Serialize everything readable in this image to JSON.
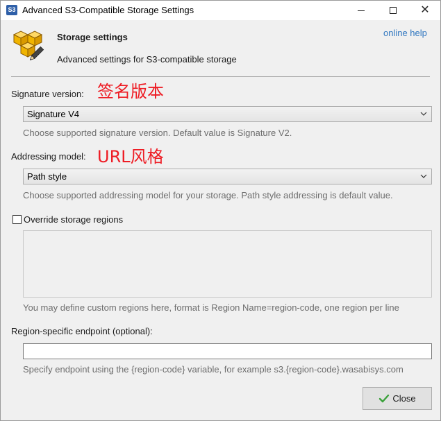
{
  "window": {
    "app_icon_text": "S3",
    "title": "Advanced S3-Compatible Storage Settings",
    "controls": {
      "minimize_icon": "minimize-icon",
      "maximize_icon": "maximize-icon",
      "close_icon": "close-icon",
      "close_glyph": "✕"
    }
  },
  "header": {
    "icon": "cubes-pencil-icon",
    "title": "Storage settings",
    "subtitle": "Advanced settings for S3-compatible storage",
    "help_link": "online help"
  },
  "signature": {
    "label": "Signature version:",
    "annotation": "签名版本",
    "value": "Signature V4",
    "hint": "Choose supported signature version. Default value is Signature V2."
  },
  "addressing": {
    "label": "Addressing model:",
    "annotation": "URL风格",
    "value": "Path style",
    "hint": "Choose supported addressing model for your storage. Path style addressing is default value."
  },
  "regions": {
    "checkbox_label": "Override storage regions",
    "checked": false,
    "textarea_value": "",
    "hint": "You may define custom regions here, format is Region Name=region-code, one region per line"
  },
  "endpoint": {
    "label": "Region-specific endpoint (optional):",
    "value": "",
    "hint": "Specify endpoint using the {region-code} variable, for example s3.{region-code}.wasabisys.com"
  },
  "footer": {
    "close_label": "Close",
    "close_icon": "checkmark-icon"
  },
  "colors": {
    "annotation": "#ee1c24",
    "link": "#2f76c0",
    "hint_text": "#6d6d6d",
    "checkmark": "#3aa13a"
  }
}
